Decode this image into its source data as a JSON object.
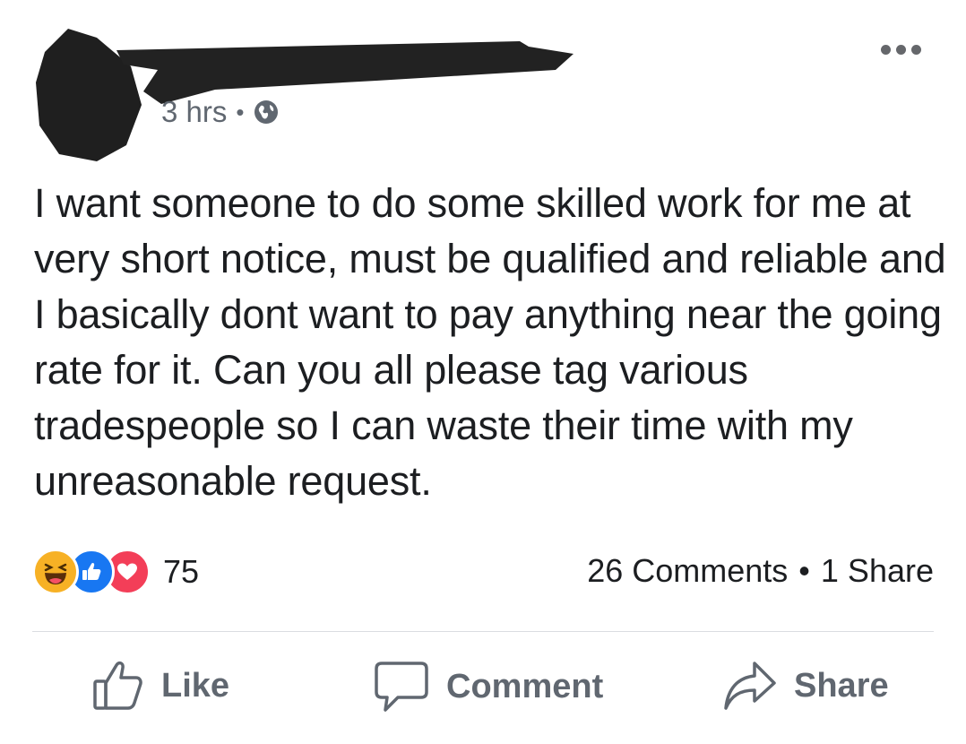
{
  "post": {
    "timestamp": "3 hrs",
    "separator": "•",
    "audience_icon": "globe-icon",
    "more_icon": "more-options-icon",
    "text": "I want someone to do some skilled work for me at very short notice, must be qualified and reliable and I basically dont want to pay anything near the going rate for it. Can you all please tag various tradespeople so I can waste their time with my unreasonable request."
  },
  "stats": {
    "reaction_icons": [
      "haha-reaction-icon",
      "like-reaction-icon",
      "love-reaction-icon"
    ],
    "reaction_count": "75",
    "comments": "26 Comments",
    "dot": "•",
    "shares": "1 Share"
  },
  "actions": {
    "like_label": "Like",
    "comment_label": "Comment",
    "share_label": "Share"
  },
  "colors": {
    "secondary_text": "#606770",
    "like_blue": "#1877f2",
    "haha_yellow": "#f7b125",
    "love_red": "#f33e58",
    "redaction": "#222222"
  }
}
